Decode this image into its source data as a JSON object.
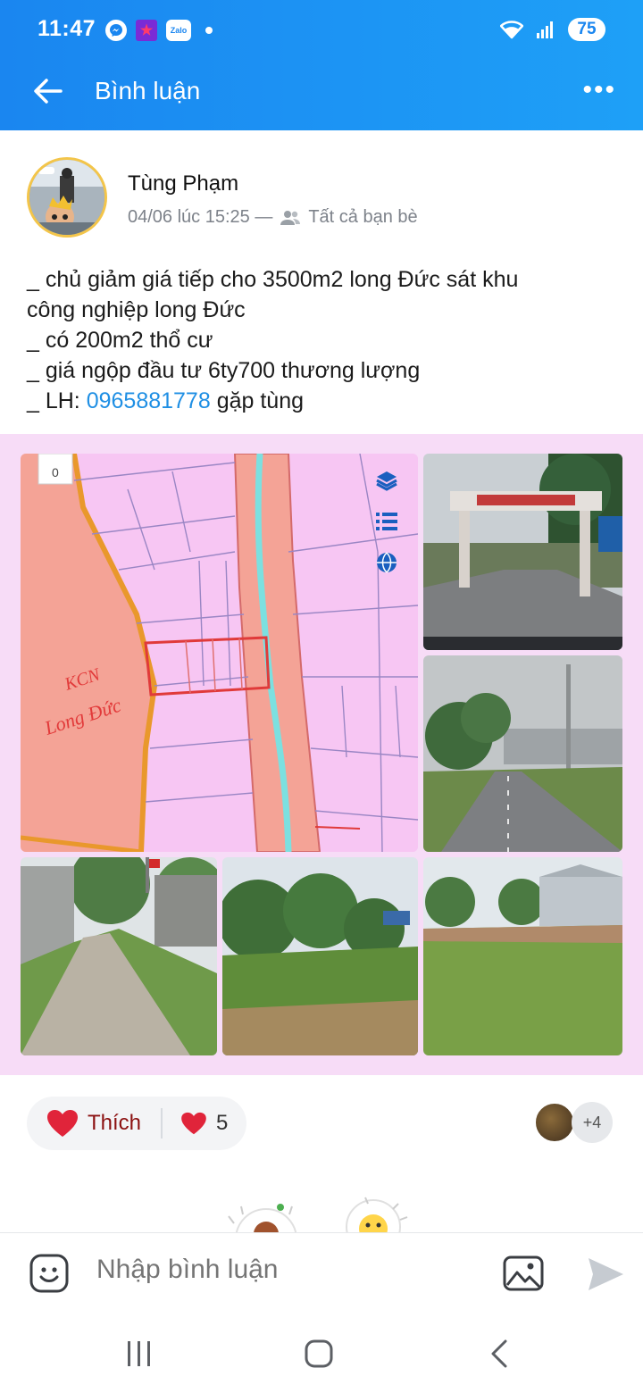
{
  "status": {
    "time": "11:47",
    "battery": "75",
    "icons": [
      "messenger-icon",
      "star-app-icon",
      "zalo-icon",
      "notification-dot",
      "wifi-icon",
      "signal-icon"
    ]
  },
  "header": {
    "title": "Bình luận",
    "back_icon": "arrow-left-icon",
    "more_icon": "more-dots-icon"
  },
  "post": {
    "author": "Tùng Phạm",
    "date": "04/06 lúc 15:25 —",
    "privacy": "Tất cả bạn bè",
    "lines": [
      "_ chủ giảm giá tiếp cho 3500m2 long Đức sát khu",
      "công nghiệp long Đức",
      "_ có 200m2 thổ cư",
      "_ giá ngộp đầu tư 6ty700 thương lượng"
    ],
    "contact_prefix": "_ LH: ",
    "contact_phone": "0965881778",
    "contact_suffix": " gặp tùng",
    "map_label_line1": "KCN",
    "map_label_line2": "Long Đức",
    "map_scale": "0"
  },
  "reactions": {
    "like_label": "Thích",
    "like_count": "5",
    "more_likers": "+4"
  },
  "comment_bar": {
    "placeholder": "Nhập bình luận"
  },
  "colors": {
    "header": "#1a86f0",
    "photo_background": "#f7dcf7",
    "phone_link": "#1f8fe4",
    "heart": "#e0243a"
  }
}
